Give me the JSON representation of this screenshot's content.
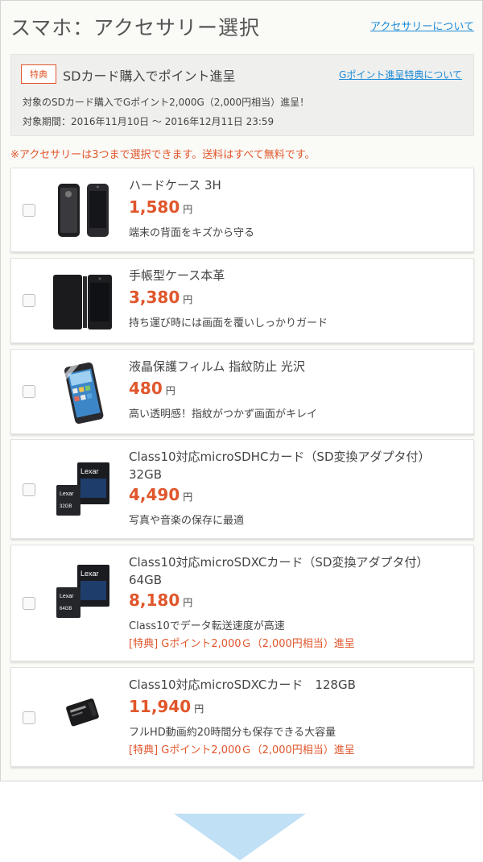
{
  "header": {
    "title": "スマホ：アクセサリー選択",
    "about_link": "アクセサリーについて"
  },
  "promo": {
    "badge": "特典",
    "title": "SDカード購入でポイント進呈",
    "link": "Gポイント進呈特典について",
    "line1": "対象のSDカード購入でGポイント2,000G（2,000円相当）進呈！",
    "line2": "対象期間：2016年11月10日 〜 2016年12月11日 23:59"
  },
  "notice": "※アクセサリーは3つまで選択できます。送料はすべて無料です。",
  "currency": "円",
  "items": [
    {
      "name": "ハードケース 3H",
      "price": "1,580",
      "desc": "端末の背面をキズから守る",
      "icon": "hard-case-icon"
    },
    {
      "name": "手帳型ケース本革",
      "price": "3,380",
      "desc": "持ち運び時には画面を覆いしっかりガード",
      "icon": "flip-case-icon"
    },
    {
      "name": "液晶保護フィルム 指紋防止 光沢",
      "price": "480",
      "desc": "高い透明感！指紋がつかず画面がキレイ",
      "icon": "screen-film-icon"
    },
    {
      "name": "Class10対応microSDHCカード（SD変換アダプタ付）",
      "name2": "32GB",
      "price": "4,490",
      "desc": "写真や音楽の保存に最適",
      "icon": "sdhc-card-icon",
      "card_label": "32GB"
    },
    {
      "name": "Class10対応microSDXCカード（SD変換アダプタ付）",
      "name2": "64GB",
      "price": "8,180",
      "desc": "Class10でデータ転送速度が高速",
      "bonus": "[特典] Gポイント2,000Ｇ（2,000円相当）進呈",
      "icon": "sdxc-card-icon",
      "card_label": "64GB"
    },
    {
      "name": "Class10対応microSDXCカード　128GB",
      "price": "11,940",
      "desc": "フルHD動画約20時間分も保存できる大容量",
      "bonus": "[特典] Gポイント2,000Ｇ（2,000円相当）進呈",
      "icon": "microsd-card-icon"
    }
  ],
  "brand_text": "Lexar",
  "colors": {
    "accent": "#e0562b",
    "link": "#1a8ad6",
    "arrow": "#bfe0f5"
  }
}
